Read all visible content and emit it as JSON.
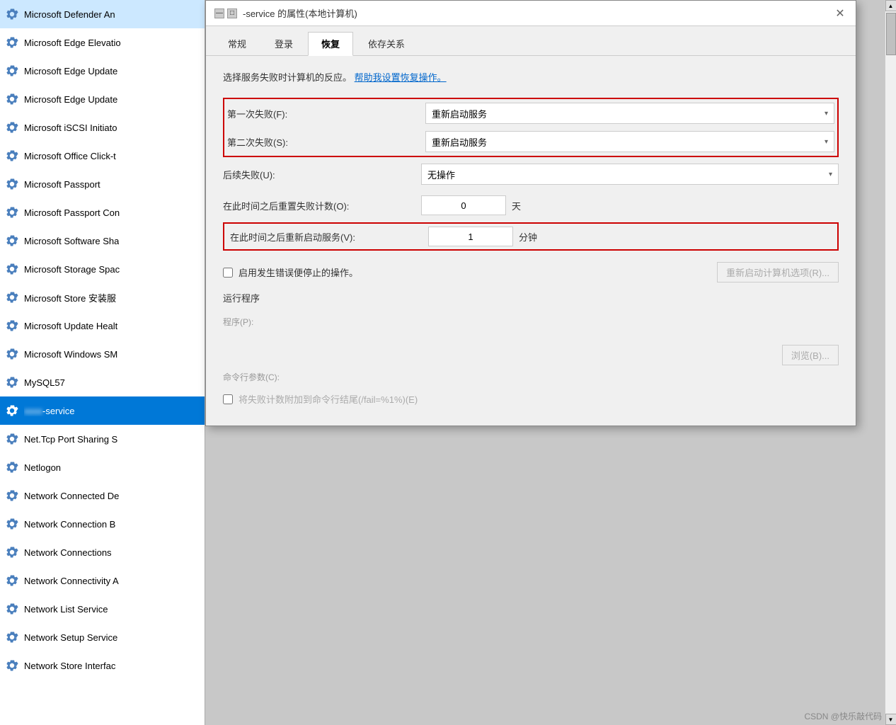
{
  "dialog": {
    "title": "-service 的属性(本地计算机)",
    "tabs": [
      {
        "id": "general",
        "label": "常规"
      },
      {
        "id": "login",
        "label": "登录"
      },
      {
        "id": "recovery",
        "label": "恢复",
        "active": true
      },
      {
        "id": "deps",
        "label": "依存关系"
      }
    ],
    "description": "选择服务失败时计算机的反应。",
    "help_link": "帮助我设置恢复操作。",
    "first_failure_label": "第一次失败(F):",
    "first_failure_value": "重新启动服务",
    "second_failure_label": "第二次失败(S):",
    "second_failure_value": "重新启动服务",
    "subsequent_failure_label": "后续失败(U):",
    "subsequent_failure_value": "无操作",
    "reset_count_label": "在此时间之后重置失败计数(O):",
    "reset_count_value": "0",
    "reset_count_unit": "天",
    "restart_service_label": "在此时间之后重新启动服务(V):",
    "restart_service_value": "1",
    "restart_service_unit": "分钟",
    "stop_on_error_label": "启用发生错误便停止的操作。",
    "restart_computer_btn": "重新启动计算机选项(R)...",
    "run_program_title": "运行程序",
    "program_label": "程序(P):",
    "browse_btn": "浏览(B)...",
    "cmdargs_label": "命令行参数(C):",
    "append_label": "将失败计数附加到命令行结尾(/fail=%1%)(E)"
  },
  "services": [
    {
      "name": "Microsoft Defender An"
    },
    {
      "name": "Microsoft Edge Elevatio"
    },
    {
      "name": "Microsoft Edge Update"
    },
    {
      "name": "Microsoft Edge Update"
    },
    {
      "name": "Microsoft iSCSI Initiato"
    },
    {
      "name": "Microsoft Office Click-t"
    },
    {
      "name": "Microsoft Passport"
    },
    {
      "name": "Microsoft Passport Con"
    },
    {
      "name": "Microsoft Software Sha"
    },
    {
      "name": "Microsoft Storage Spac"
    },
    {
      "name": "Microsoft Store 安装服"
    },
    {
      "name": "Microsoft Update Healt"
    },
    {
      "name": "Microsoft Windows SM"
    },
    {
      "name": "MySQL57"
    },
    {
      "name": "-service",
      "selected": true
    },
    {
      "name": "Net.Tcp Port Sharing S"
    },
    {
      "name": "Netlogon"
    },
    {
      "name": "Network Connected De"
    },
    {
      "name": "Network Connection B"
    },
    {
      "name": "Network Connections"
    },
    {
      "name": "Network Connectivity A"
    },
    {
      "name": "Network List Service"
    },
    {
      "name": "Network Setup Service"
    },
    {
      "name": "Network Store Interfac"
    }
  ],
  "watermark": "CSDN @快乐敲代码"
}
